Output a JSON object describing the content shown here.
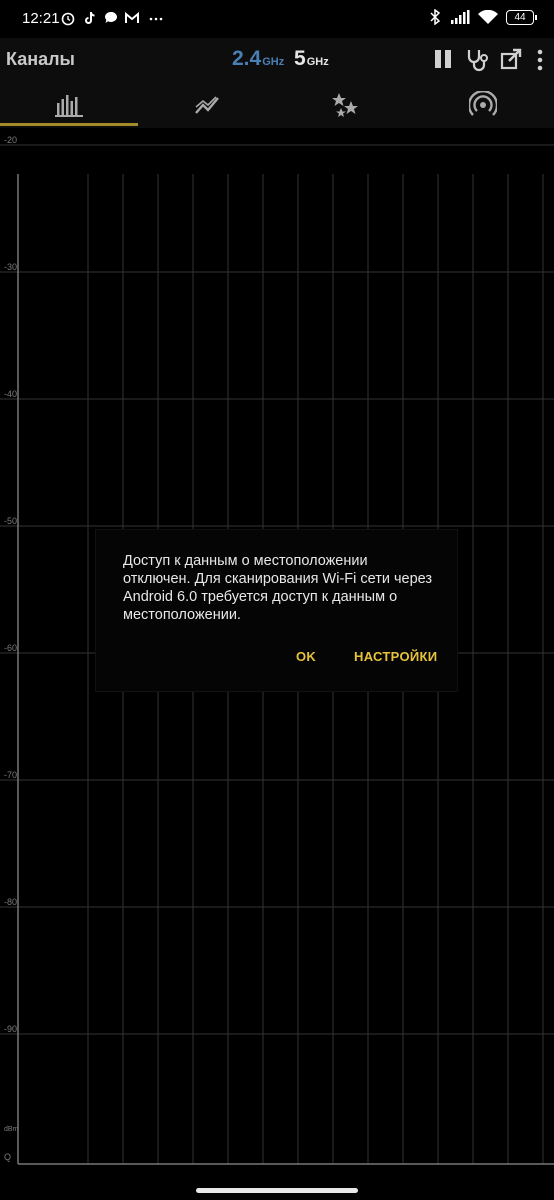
{
  "status_bar": {
    "time": "12:21",
    "battery": "44"
  },
  "app_bar": {
    "title": "Каналы",
    "band_24_value": "2.4",
    "band_24_unit": "GHz",
    "band_5_value": "5",
    "band_5_unit": "GHz"
  },
  "tabs": [
    "channel-graph",
    "time-graph",
    "channel-rating",
    "access-points"
  ],
  "chart": {
    "y_ticks": [
      "-20",
      "-30",
      "-40",
      "-50",
      "-60",
      "-70",
      "-80",
      "-90"
    ],
    "y_unit": "dBm",
    "y_bottom": "Q"
  },
  "dialog": {
    "message": "Доступ к данным о местоположении отключен. Для сканирования Wi-Fi сети через Android 6.0 требуется доступ к данным о местоположении.",
    "ok_label": "OK",
    "settings_label": "НАСТРОЙКИ"
  },
  "colors": {
    "accent": "#e6c23d",
    "band_24": "#4a7fb3",
    "tab_indicator": "#a38b27"
  }
}
